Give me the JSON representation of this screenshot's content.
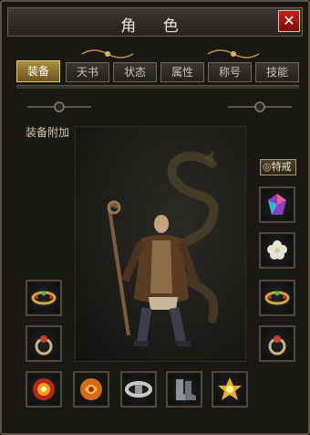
{
  "window": {
    "title": "角 色",
    "close_glyph": "✕"
  },
  "tabs": [
    {
      "label": "装备",
      "active": true
    },
    {
      "label": "天书",
      "active": false
    },
    {
      "label": "状态",
      "active": false
    },
    {
      "label": "属性",
      "active": false
    },
    {
      "label": "称号",
      "active": false
    },
    {
      "label": "技能",
      "active": false
    }
  ],
  "equipment": {
    "bonus_label": "装备附加",
    "special_button": "特戒",
    "slots": [
      {
        "icon": "gem-icon"
      },
      {
        "icon": "chrysanthemum-icon"
      },
      {
        "icon": "bracelet-icon"
      },
      {
        "icon": "ring-icon"
      },
      {
        "icon": "bracelet-icon"
      },
      {
        "icon": "ring-icon"
      },
      {
        "icon": "fire-amulet-icon"
      },
      {
        "icon": "dragon-talisman-icon"
      },
      {
        "icon": "silver-belt-icon"
      },
      {
        "icon": "boots-icon"
      },
      {
        "icon": "golden-sigil-icon"
      }
    ]
  },
  "colors": {
    "accent_gold": "#c9a44a",
    "close_red": "#b81b1b",
    "panel_bg": "#1a1815"
  }
}
